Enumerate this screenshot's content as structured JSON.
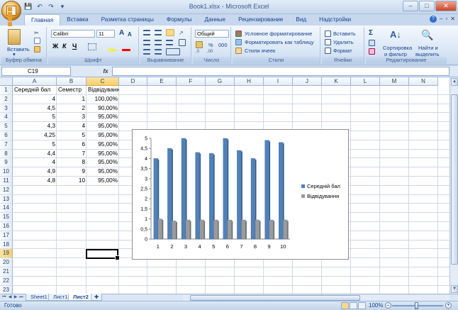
{
  "window": {
    "title": "Book1.xlsx - Microsoft Excel",
    "min": "–",
    "max": "□",
    "close": "✕"
  },
  "ribbon_tabs": [
    "Главная",
    "Вставка",
    "Разметка страницы",
    "Формулы",
    "Данные",
    "Рецензирование",
    "Вид",
    "Надстройки"
  ],
  "clipboard": {
    "paste": "Вставить",
    "group": "Буфер обмена"
  },
  "font": {
    "name": "Calibri",
    "size": "11",
    "bold": "Ж",
    "italic": "К",
    "underline": "Ч",
    "grow": "A",
    "shrink": "A",
    "group": "Шрифт"
  },
  "alignment": {
    "group": "Выравнивание"
  },
  "number": {
    "format": "Общий",
    "percent": "%",
    "thousands": "000",
    "group": "Число"
  },
  "styles": {
    "cond": "Условное форматирование",
    "table": "Форматировать как таблицу",
    "cell": "Стили ячеек",
    "group": "Стили"
  },
  "cells": {
    "insert": "Вставить",
    "delete": "Удалить",
    "format": "Формат",
    "group": "Ячейки"
  },
  "editing": {
    "sigma": "Σ",
    "sort": "Сортировка",
    "sort2": "и фильтр",
    "find": "Найти и",
    "find2": "выделить",
    "group": "Редактирование"
  },
  "formula_bar": {
    "name_box": "C19",
    "fx": "fx",
    "value": ""
  },
  "columns": [
    "A",
    "B",
    "C",
    "D",
    "E",
    "F",
    "G",
    "H",
    "I",
    "J",
    "K",
    "L",
    "M",
    "N"
  ],
  "rows": [
    "1",
    "2",
    "3",
    "4",
    "5",
    "6",
    "7",
    "8",
    "9",
    "10",
    "11",
    "12",
    "13",
    "14",
    "15",
    "16",
    "17",
    "18",
    "19",
    "20",
    "21",
    "22",
    "23"
  ],
  "headers": [
    "Середній бал",
    "Семестр",
    "Відвідування"
  ],
  "table": [
    [
      "4",
      "1",
      "100,00%"
    ],
    [
      "4,5",
      "2",
      "90,00%"
    ],
    [
      "5",
      "3",
      "95,00%"
    ],
    [
      "4,3",
      "4",
      "95,00%"
    ],
    [
      "4,25",
      "5",
      "95,00%"
    ],
    [
      "5",
      "6",
      "95,00%"
    ],
    [
      "4,4",
      "7",
      "95,00%"
    ],
    [
      "4",
      "8",
      "95,00%"
    ],
    [
      "4,9",
      "9",
      "95,00%"
    ],
    [
      "4,8",
      "10",
      "95,00%"
    ]
  ],
  "chart_data": {
    "type": "bar",
    "categories": [
      "1",
      "2",
      "3",
      "4",
      "5",
      "6",
      "7",
      "8",
      "9",
      "10"
    ],
    "series": [
      {
        "name": "Середній бал",
        "values": [
          4,
          4.5,
          5,
          4.3,
          4.25,
          5,
          4.4,
          4,
          4.9,
          4.8
        ],
        "color": "#4f81bd"
      },
      {
        "name": "Відвідування",
        "values": [
          1,
          0.9,
          0.95,
          0.95,
          0.95,
          0.95,
          0.95,
          0.95,
          0.95,
          0.95
        ],
        "color": "#9b9b9b"
      }
    ],
    "yticks": [
      "0",
      "0,5",
      "1",
      "1,5",
      "2",
      "2,5",
      "3",
      "3,5",
      "4",
      "4,5",
      "5"
    ],
    "ylim": [
      0,
      5
    ],
    "legend": "right",
    "grid": false
  },
  "sheets": [
    "Sheet1",
    "Лист1",
    "Лист2"
  ],
  "active_sheet": "Лист2",
  "status": {
    "ready": "Готово",
    "zoom": "100%"
  }
}
